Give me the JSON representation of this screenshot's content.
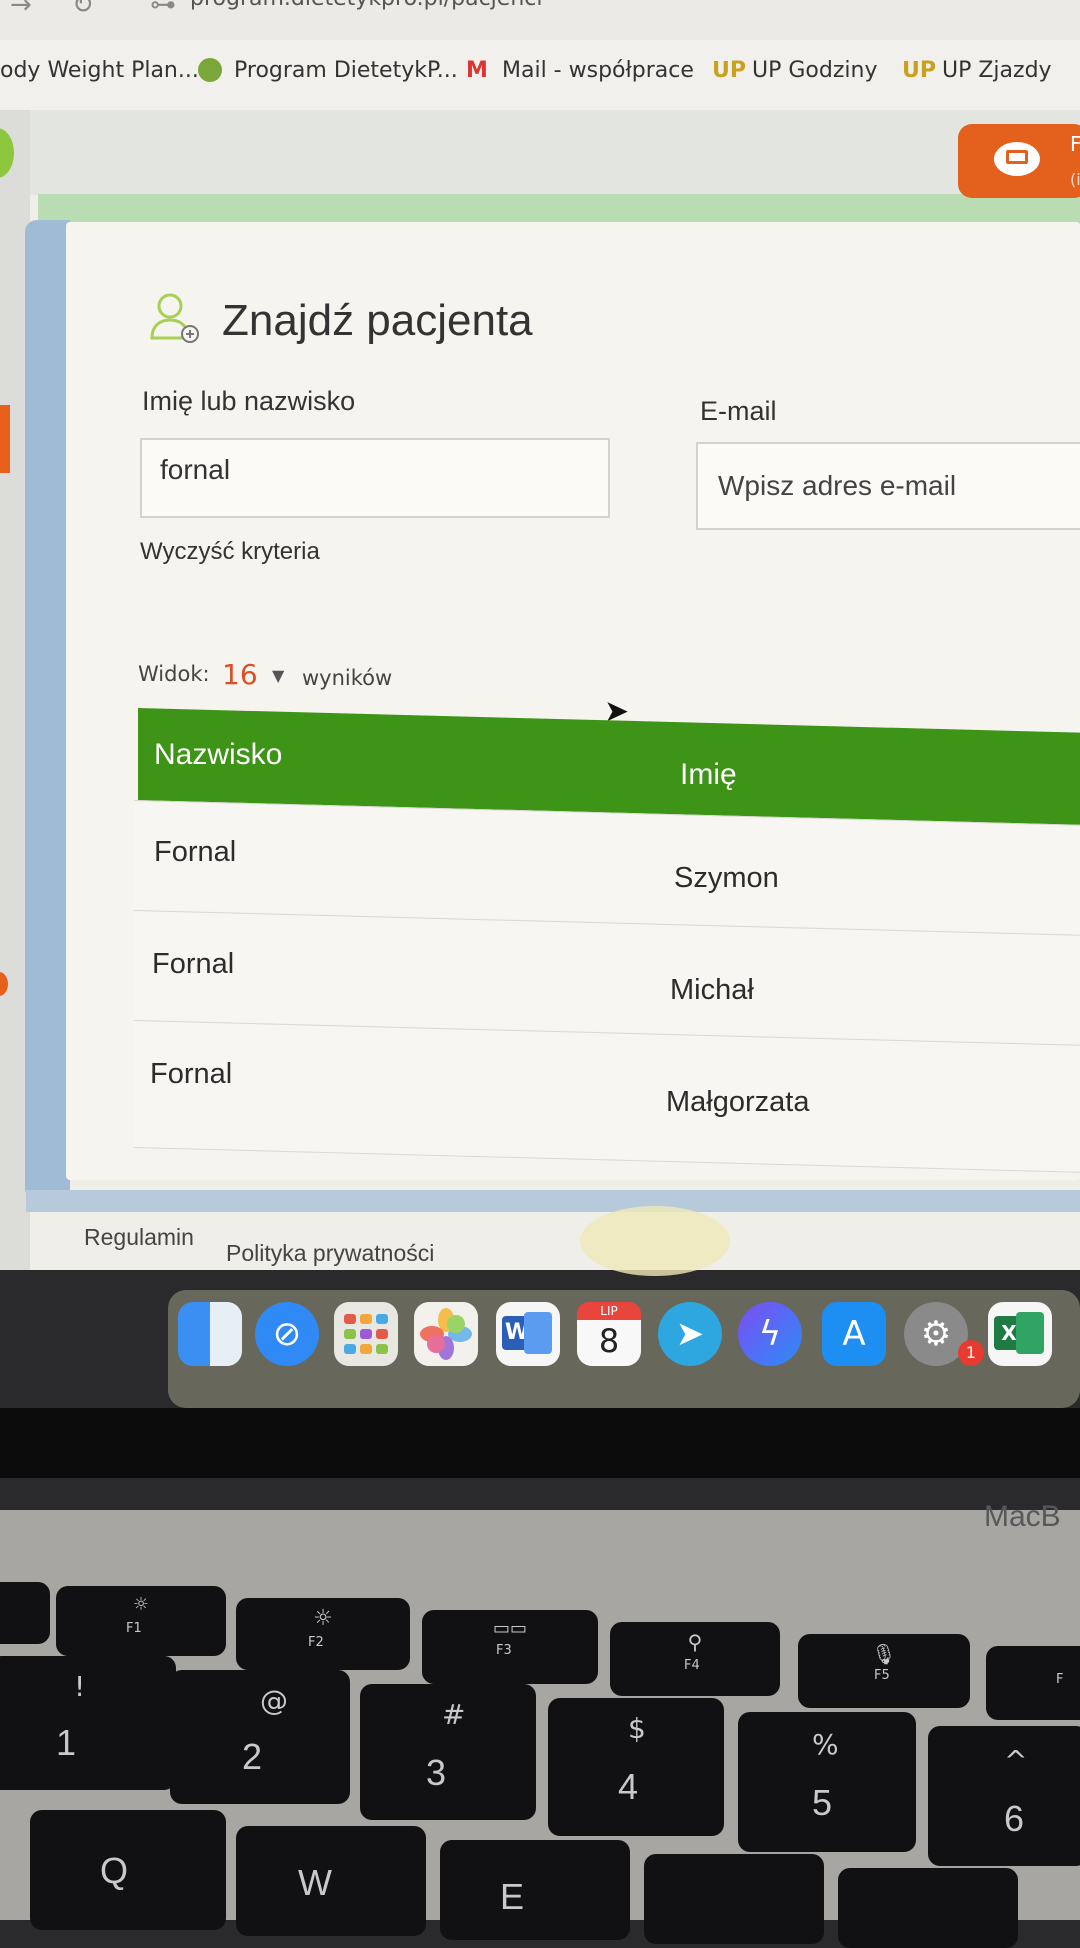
{
  "browser": {
    "url": "program.dietetykpro.pl/pacjenci",
    "bookmarks": [
      {
        "label": "ody Weight Plan..."
      },
      {
        "label": "Program DietetykP..."
      },
      {
        "label": "Mail - współprace"
      },
      {
        "label": "UP Godziny"
      },
      {
        "label": "UP Zjazdy"
      }
    ]
  },
  "header": {
    "present_letter": "F",
    "present_sub": "(i"
  },
  "search": {
    "title": "Znajdź pacjenta",
    "name_label": "Imię lub nazwisko",
    "name_value": "fornal",
    "email_label": "E-mail",
    "email_placeholder": "Wpisz adres e-mail",
    "clear_label": "Wyczyść kryteria"
  },
  "view": {
    "label": "Widok:",
    "count": "16",
    "suffix": "wyników"
  },
  "table": {
    "headers": [
      "Nazwisko",
      "Imię"
    ],
    "rows": [
      [
        "Fornal",
        "Szymon"
      ],
      [
        "Fornal",
        "Michał"
      ],
      [
        "Fornal",
        "Małgorzata"
      ]
    ]
  },
  "footer": {
    "terms": "Regulamin",
    "privacy": "Polityka prywatności"
  },
  "dock": {
    "calendar_month": "LIP",
    "calendar_day": "8",
    "settings_badge": "1"
  },
  "laptop": {
    "brand": "MacB",
    "fkeys": [
      "F1",
      "F2",
      "F3",
      "F4",
      "F5",
      "F"
    ],
    "num_top": [
      "!",
      "@",
      "#",
      "$",
      "%",
      "^"
    ],
    "num_bottom": [
      "1",
      "2",
      "3",
      "4",
      "5",
      "6"
    ],
    "letters": [
      "Q",
      "W",
      "E"
    ]
  },
  "colors": {
    "accent_green": "#3d9416",
    "accent_orange": "#e3611c",
    "count_red": "#d9502a"
  }
}
